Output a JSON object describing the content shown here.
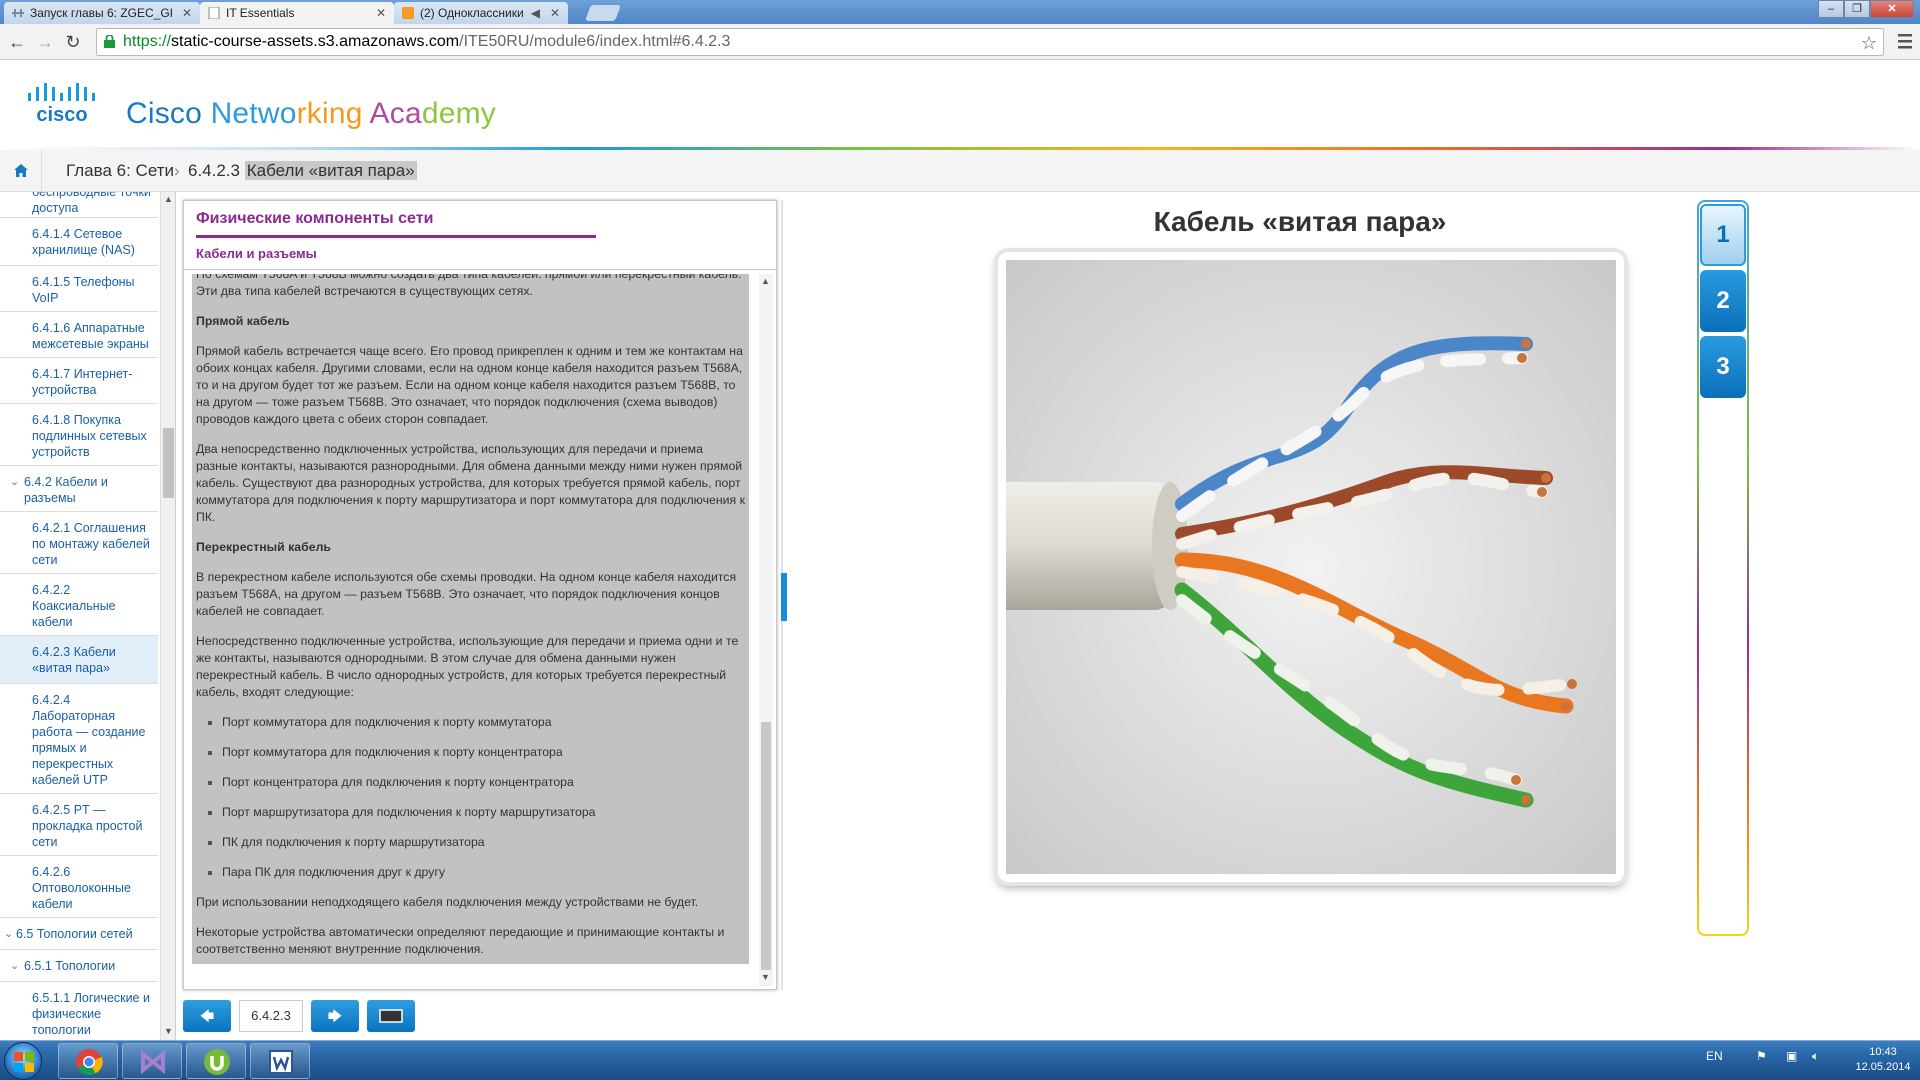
{
  "browser": {
    "tabs": [
      {
        "title": "Запуск главы 6: ZGEC_GI",
        "active": false
      },
      {
        "title": "IT Essentials",
        "active": true
      },
      {
        "title": "(2) Одноклассники",
        "active": false
      }
    ],
    "url_scheme": "https://",
    "url_host": "static-course-assets.s3.amazonaws.com",
    "url_path": "/ITE50RU/module6/index.html#6.4.2.3"
  },
  "header": {
    "logo_text": "cisco",
    "brand_parts": [
      "Cisco ",
      "Netwo",
      "rking ",
      "Aca",
      "demy"
    ],
    "brand_colors": [
      "#1a7ac0",
      "#2f9ad8",
      "#f39a1e",
      "#b04aa0",
      "#8cc63f"
    ]
  },
  "breadcrumb": {
    "chapter": "Глава 6: Сети",
    "separator": "›",
    "current_num": "6.4.2.3",
    "current_title": "Кабели «витая пара»"
  },
  "sidenav": {
    "items": [
      {
        "label": "беспроводные точки доступа",
        "level": 3
      },
      {
        "label": "6.4.1.4 Сетевое хранилище (NAS)",
        "level": 3
      },
      {
        "label": "6.4.1.5 Телефоны VoIP",
        "level": 3
      },
      {
        "label": "6.4.1.6 Аппаратные межсетевые экраны",
        "level": 3
      },
      {
        "label": "6.4.1.7 Интернет-устройства",
        "level": 3
      },
      {
        "label": "6.4.1.8 Покупка подлинных сетевых устройств",
        "level": 3
      },
      {
        "label": "6.4.2 Кабели и разъемы",
        "level": 2
      },
      {
        "label": "6.4.2.1 Соглашения по монтажу кабелей сети",
        "level": 3
      },
      {
        "label": "6.4.2.2 Коаксиальные кабели",
        "level": 3
      },
      {
        "label": "6.4.2.3 Кабели «витая пара»",
        "level": 3
      },
      {
        "label": "6.4.2.4 Лабораторная работа — создание прямых и перекрестных кабелей UTP",
        "level": 3
      },
      {
        "label": "6.4.2.5 PT — прокладка простой сети",
        "level": 3
      },
      {
        "label": "6.4.2.6 Оптоволоконные кабели",
        "level": 3
      },
      {
        "label": "6.5 Топологии сетей",
        "level": 1
      },
      {
        "label": "6.5.1 Топологии",
        "level": 2
      },
      {
        "label": "6.5.1.1 Логические и физические топологии",
        "level": 3
      }
    ]
  },
  "panel": {
    "title": "Физические компоненты сети",
    "subtitle": "Кабели и разъемы",
    "top_partial": "По схемам T568A и T568B можно создать два типа кабелей: прямой или перекрестный кабель. Эти два типа кабелей встречаются в существующих сетях.",
    "h_straight": "Прямой кабель",
    "p_straight": "Прямой кабель встречается чаще всего. Его провод прикреплен к одним и тем же контактам на обоих концах кабеля. Другими словами, если на одном конце кабеля находится разъем T568A, то и на другом будет тот же разъем. Если на одном конце кабеля находится разъем T568B, то на другом — тоже разъем T568B. Это означает, что порядок подключения (схема выводов) проводов каждого цвета с обеих сторон совпадает.",
    "p_hetero": "Два непосредственно подключенных устройства, использующих для передачи и приема разные контакты, называются разнородными. Для обмена данными между ними нужен прямой кабель. Существуют два разнородных устройства, для которых требуется прямой кабель, порт коммутатора для подключения к порту маршрутизатора и порт коммутатора для подключения к ПК.",
    "h_cross": "Перекрестный кабель",
    "p_cross": "В перекрестном кабеле используются обе схемы проводки. На одном конце кабеля находится разъем T568A, на другом — разъем T568B. Это означает, что порядок подключения концов кабелей не совпадает.",
    "p_homo": "Непосредственно подключенные устройства, использующие для передачи и приема одни и те же контакты, называются однородными. В этом случае для обмена данными нужен перекрестный кабель. В число однородных устройств, для которых требуется перекрестный кабель, входят следующие:",
    "list": [
      "Порт коммутатора для подключения к порту коммутатора",
      "Порт коммутатора для подключения к порту концентратора",
      "Порт концентратора для подключения к порту концентратора",
      "Порт маршрутизатора для подключения к порту маршрутизатора",
      "ПК для подключения к порту маршрутизатора",
      "Пара ПК для подключения друг к другу"
    ],
    "p_wrong": "При использовании неподходящего кабеля подключения между устройствами не будет.",
    "p_auto": "Некоторые устройства автоматически определяют передающие и принимающие контакты и соответственно меняют внутренние подключения."
  },
  "pager": {
    "prev": "🡄",
    "page": "6.4.2.3",
    "next": "🡆"
  },
  "media": {
    "title": "Кабель «витая пара»",
    "steps": [
      "1",
      "2",
      "3"
    ],
    "selected_step": "1"
  },
  "taskbar": {
    "lang": "EN",
    "time": "10:43",
    "date": "12.05.2014"
  }
}
